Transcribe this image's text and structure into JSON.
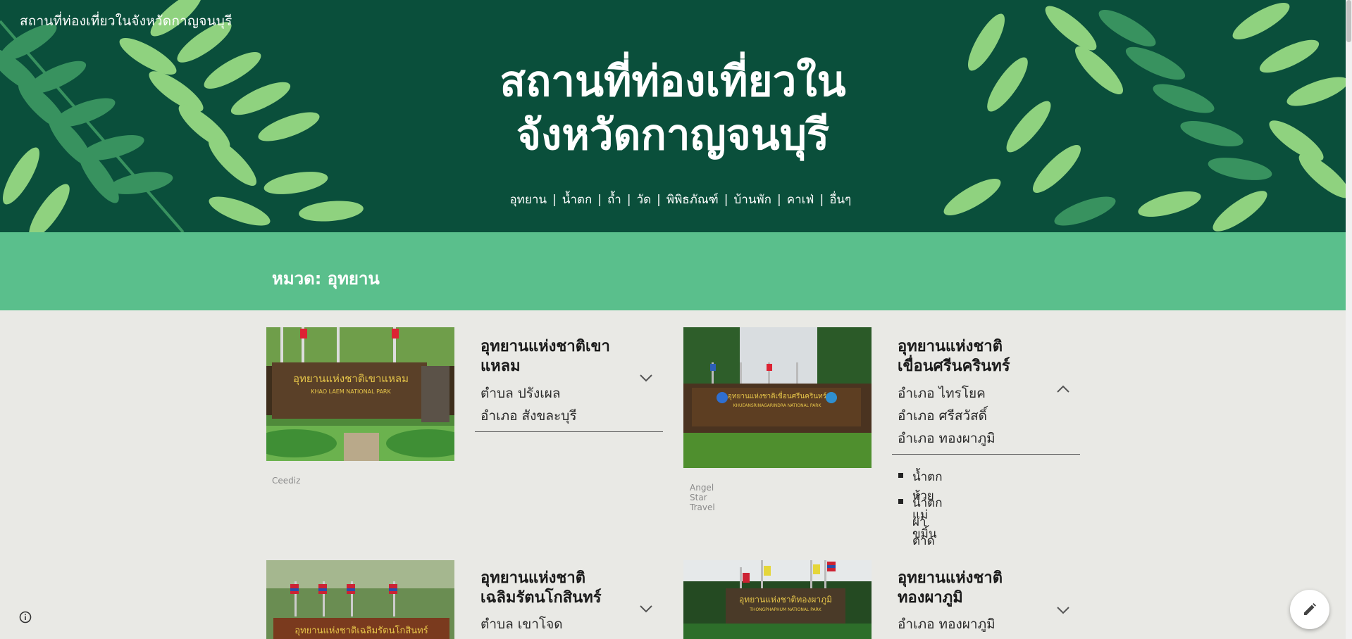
{
  "site": {
    "title": "สถานที่ท่องเที่ยวในจังหวัดกาญจนบุรี"
  },
  "hero": {
    "title_line1": "สถานที่ท่องเที่ยวใน",
    "title_line2": "จังหวัดกาญจนบุรี",
    "nav": [
      {
        "label": "อุทยาน"
      },
      {
        "label": "น้ำตก"
      },
      {
        "label": "ถ้ำ"
      },
      {
        "label": "วัด"
      },
      {
        "label": "พิพิธภัณฑ์"
      },
      {
        "label": "บ้านพัก"
      },
      {
        "label": "คาเฟ่"
      },
      {
        "label": "อื่นๆ"
      }
    ],
    "separator": "|"
  },
  "category": {
    "title": "หมวด: อุทยาน"
  },
  "cards": [
    {
      "name": "อุทยานแห่งชาติเขาแหลม",
      "name_line1": "อุทยานแห่งชาติเขา",
      "name_line2": "แหลม",
      "lines": [
        "ตำบล ปรังเผล",
        "อำเภอ สังขละบุรี"
      ],
      "credit": "Ceediz",
      "sign_text": "อุทยานแห่งชาติเขาแหลม",
      "sign_sub": "KHAO LAEM NATIONAL PARK",
      "expanded": false
    },
    {
      "name": "อุทยานแห่งชาติเขื่อนศรีนครินทร์",
      "name_line1": "อุทยานแห่งชาติ",
      "name_line2": "เขื่อนศรีนครินทร์",
      "lines": [
        "อำเภอ ไทรโยค",
        "อำเภอ ศรีสวัสดิ์",
        "อำเภอ ทองผาภูมิ"
      ],
      "credit": "Angel Star Travel",
      "sign_text": "อุทยานแห่งชาติเขื่อนศรีนครินทร์",
      "sign_sub": "KHUEANSRINAGARINDRA NATIONAL PARK",
      "expanded": true,
      "sub_items": [
        "น้ำตกห้วยแม่ขมิ้น",
        "น้ำตกผาตาด"
      ]
    },
    {
      "name": "อุทยานแห่งชาติเฉลิมรัตนโกสินทร์",
      "name_line1": "อุทยานแห่งชาติ",
      "name_line2": "เฉลิมรัตนโกสินทร์",
      "lines": [
        "ตำบล เขาโจด"
      ],
      "sign_text": "อุทยานแห่งชาติเฉลิมรัตนโกสินทร์",
      "expanded": false
    },
    {
      "name": "อุทยานแห่งชาติทองผาภูมิ",
      "name_line1": "อุทยานแห่งชาติ",
      "name_line2": "ทองผาภูมิ",
      "lines": [
        "อำเภอ ทองผาภูมิ"
      ],
      "sign_text": "อุทยานแห่งชาติทองผาภูมิ",
      "sign_sub": "THONGPHAPHUM NATIONAL PARK",
      "expanded": false
    }
  ],
  "icons": {
    "chevron_down": "chevron-down-icon",
    "chevron_up": "chevron-up-icon",
    "info": "info-icon",
    "edit": "pencil-icon"
  },
  "colors": {
    "hero_bg": "#0a4f3b",
    "leaf_light": "#8fd27f",
    "leaf_mid": "#4fa86a",
    "band": "#5abf8c",
    "page_bg": "#e9e9e5"
  }
}
